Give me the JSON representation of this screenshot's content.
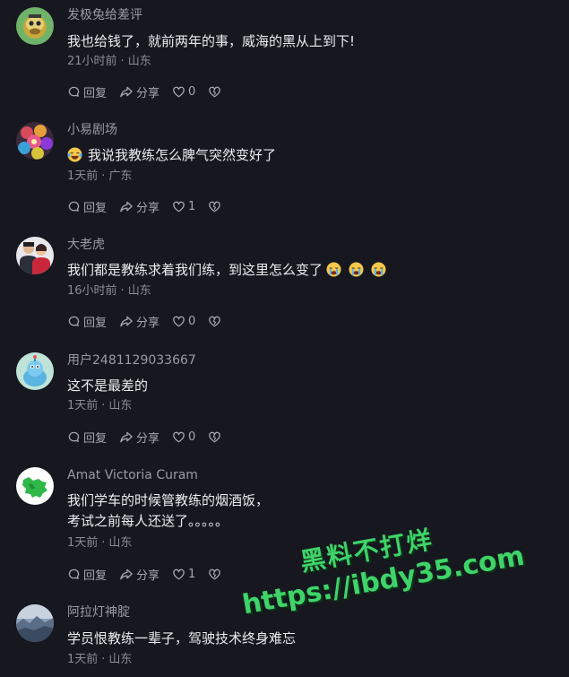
{
  "comments": [
    {
      "username": "发极兔给差评",
      "lines": [
        "我也给钱了，就前两年的事，威海的黑从上到下!"
      ],
      "time": "21小时前",
      "location": "山东",
      "reply_label": "回复",
      "share_label": "分享",
      "likes": "0",
      "avatar_icon": "ape-avatar"
    },
    {
      "username": "小易剧场",
      "lines": [
        "我说我教练怎么脾气突然变好了"
      ],
      "leading_emoji": "laughing-tears-emoji",
      "time": "1天前",
      "location": "广东",
      "reply_label": "回复",
      "share_label": "分享",
      "likes": "1",
      "avatar_icon": "flower-avatar"
    },
    {
      "username": "大老虎",
      "lines": [
        "我们都是教练求着我们练，到这里怎么变了"
      ],
      "trailing_emoji_count": 3,
      "time": "16小时前",
      "location": "山东",
      "reply_label": "回复",
      "share_label": "分享",
      "likes": "0",
      "avatar_icon": "couple-photo-avatar"
    },
    {
      "username": "用户2481129033667",
      "lines": [
        "这不是最差的"
      ],
      "time": "1天前",
      "location": "山东",
      "reply_label": "回复",
      "share_label": "分享",
      "likes": "0",
      "avatar_icon": "blue-bird-avatar"
    },
    {
      "username": "Amat Victoria Curam",
      "lines": [
        "我们学车的时候管教练的烟酒饭，",
        "考试之前每人还送了。。。。。"
      ],
      "time": "1天前",
      "location": "山东",
      "reply_label": "回复",
      "share_label": "分享",
      "likes": "1",
      "avatar_icon": "green-map-avatar"
    },
    {
      "username": "阿拉灯神腚",
      "lines": [
        "学员恨教练一辈子，驾驶技术终身难忘"
      ],
      "time": "1天前",
      "location": "山东",
      "avatar_icon": "landscape-avatar"
    }
  ],
  "watermark": {
    "line1": "黑料不打烊",
    "line2": "https://ibdy35.com"
  },
  "colors": {
    "background": "#16171f",
    "username": "#9a9ba6",
    "text": "#ececef",
    "meta": "#8b8c96",
    "watermark": "#3fd36a"
  }
}
